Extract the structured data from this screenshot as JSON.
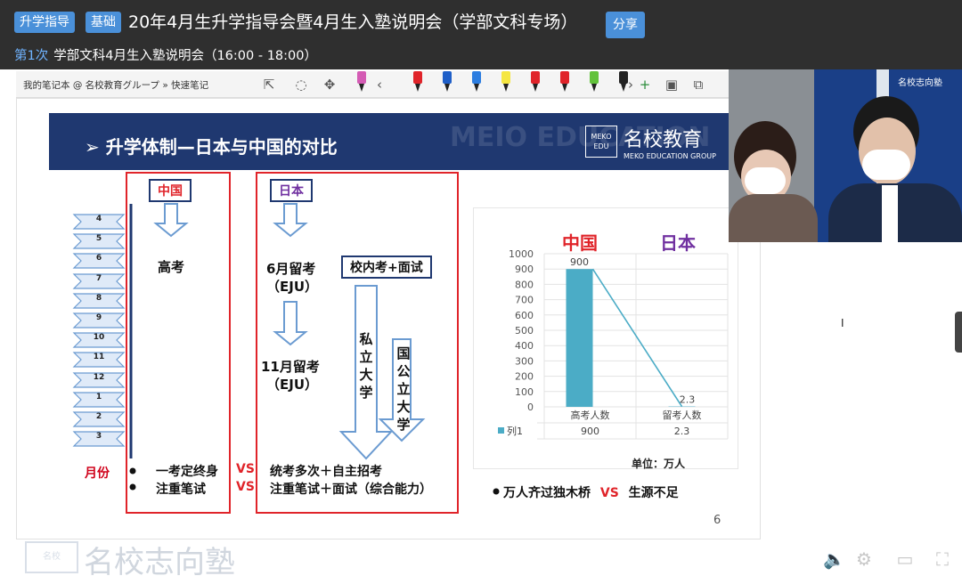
{
  "header": {
    "tags": [
      "升学指导",
      "基础"
    ],
    "title": "20年4月生升学指导会暨4月生入塾说明会（学部文科专场）",
    "share_label": "分享",
    "session_no": "第1次",
    "session_title": "学部文科4月生入塾说明会（16:00 - 18:00）"
  },
  "toolbar": {
    "breadcrumb": "我的笔记本 @ 名校教育グループ » 快速笔记",
    "icons": [
      "select-text-icon",
      "lasso-icon",
      "move-icon"
    ],
    "pen_colors": [
      "#d45bb4",
      "#e0242a",
      "#1f5fc8",
      "#2c7de0",
      "#f5e642",
      "#e0242a",
      "#e0242a",
      "#62c23b",
      "#222222"
    ],
    "nav_prev": "‹",
    "nav_next": "›",
    "add": "+"
  },
  "slide": {
    "banner_title": "升学体制—日本与中国的对比",
    "banner_watermark": "MEIO EDUCATION",
    "logo_box_text": "MEKO EDU",
    "logo_text": "名校教育",
    "logo_sub": "MEKO EDUCATION GROUP",
    "months": [
      "4",
      "5",
      "6",
      "7",
      "8",
      "9",
      "10",
      "11",
      "12",
      "1",
      "2",
      "3"
    ],
    "month_label": "月份",
    "china_label": "中国",
    "china_exam": "高考",
    "japan_label": "日本",
    "japan_june_line1": "6月留考",
    "japan_june_line2": "（EJU）",
    "japan_nov_line1": "11月留考",
    "japan_nov_line2": "（EJU）",
    "school_exam_label": "校内考+面试",
    "private_univ": "私立大学",
    "public_univ": "国公立大学",
    "china_bullets": [
      "一考定终身",
      "注重笔试"
    ],
    "vs": "VS",
    "japan_lines": [
      "统考多次＋自主招考",
      "注重笔试＋面试（综合能力）"
    ],
    "page_number": "6",
    "chart_head_china": "中国",
    "chart_head_japan": "日本",
    "unit": "单位：万人",
    "bottom_bullet_text": "万人齐过独木桥",
    "bottom_bullet_right": "生源不足"
  },
  "chart_data": {
    "type": "bar",
    "categories": [
      "高考人数",
      "留考人数"
    ],
    "series": [
      {
        "name": "列1",
        "values": [
          900,
          2.3
        ]
      }
    ],
    "data_labels": [
      "900",
      "2.3"
    ],
    "table_values": [
      "900",
      "2.3"
    ],
    "ylim": [
      0,
      1000
    ],
    "yticks": [
      0,
      100,
      200,
      300,
      400,
      500,
      600,
      700,
      800,
      900,
      1000
    ],
    "grid": true,
    "colors": {
      "bar": "#4bacc6"
    }
  },
  "watermark": {
    "logo_text": "名校",
    "text": "名校志向塾"
  },
  "video": {
    "banner_text": "名校志向塾"
  }
}
